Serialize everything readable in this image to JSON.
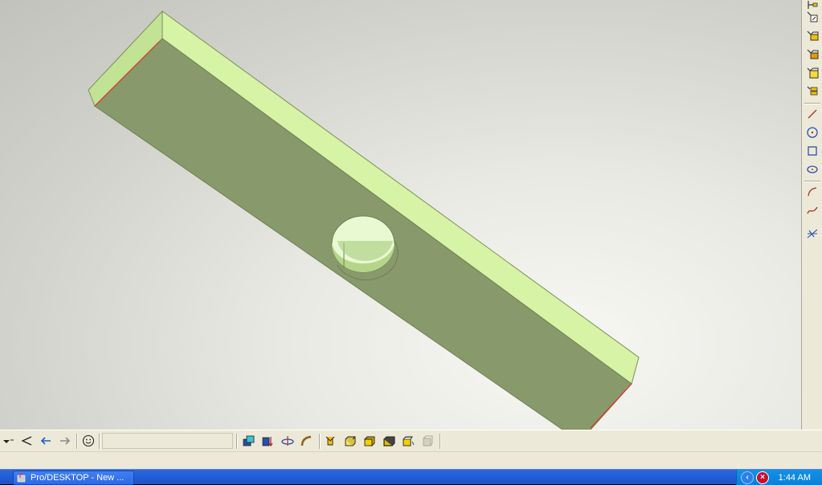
{
  "taskbar": {
    "task_label": "Pro/DESKTOP - New ...",
    "clock": "1:44 AM",
    "tray_chevron": "chevron-left-icon",
    "tray_security": "security-alert-icon"
  },
  "right_toolbar": {
    "buttons": [
      "select-feature-icon",
      "select-face-icon",
      "select-part-icon",
      "select-solid-icon",
      "select-edge-icon",
      "select-group-icon",
      "line-tool-icon",
      "circle-tool-icon",
      "rectangle-tool-icon",
      "ellipse-tool-icon",
      "arc-tool-icon",
      "spline-tool-icon",
      "trim-tool-icon"
    ]
  },
  "bottom_toolbar": {
    "left_buttons": [
      "dropdown-icon",
      "back-view-icon",
      "arrow-left-icon",
      "arrow-right-icon",
      "smiley-icon"
    ],
    "feature_buttons": [
      "extrude-icon",
      "extrude-to-icon",
      "revolve-icon",
      "sweep-icon",
      "shell-icon",
      "box-view-icon",
      "shaded-view-icon",
      "solid-view-icon",
      "rotate-view-icon",
      "disabled-view-icon"
    ]
  },
  "colors": {
    "part_face": "#889a6c",
    "part_top": "#d6f3a6",
    "part_end": "#c7e79a",
    "edge_highlight": "#e0352b",
    "taskbar": "#245edb"
  }
}
